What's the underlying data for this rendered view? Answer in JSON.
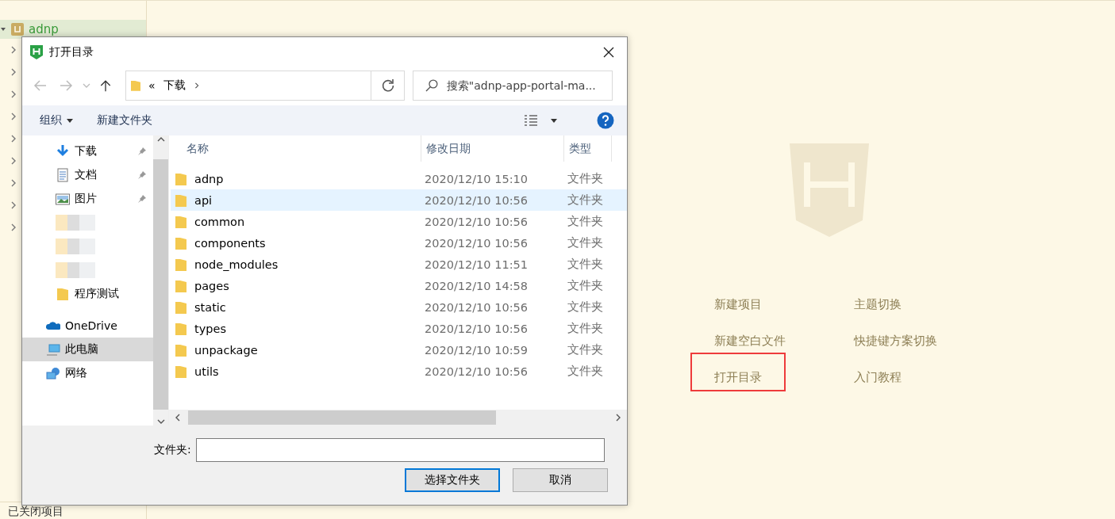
{
  "app": {
    "project": {
      "name": "adnp",
      "selected": true,
      "expanded": true
    },
    "tree_rows": [
      {
        "expanded": false
      },
      {
        "expanded": false
      },
      {
        "expanded": false
      },
      {
        "expanded": false
      },
      {
        "expanded": false
      },
      {
        "expanded": false
      },
      {
        "expanded": false
      },
      {
        "expanded": false
      },
      {
        "expanded": false
      }
    ],
    "closed_projects": "已关闭项目",
    "welcome_links": [
      {
        "label": "新建项目",
        "highlighted": false
      },
      {
        "label": "主题切换",
        "highlighted": false
      },
      {
        "label": "新建空白文件",
        "highlighted": false
      },
      {
        "label": "快捷键方案切换",
        "highlighted": false
      },
      {
        "label": "打开目录",
        "highlighted": true
      },
      {
        "label": "入门教程",
        "highlighted": false
      }
    ]
  },
  "dialog": {
    "title": "打开目录",
    "breadcrumb": [
      "«",
      "下载"
    ],
    "search": {
      "placeholder": "搜索\"adnp-app-portal-ma..."
    },
    "toolbar": {
      "organize": "组织",
      "new_folder": "新建文件夹"
    },
    "nav": [
      {
        "kind": "download",
        "label": "下载",
        "pinned": true,
        "selected": false
      },
      {
        "kind": "documents",
        "label": "文档",
        "pinned": true,
        "selected": false
      },
      {
        "kind": "pictures",
        "label": "图片",
        "pinned": true,
        "selected": false
      },
      {
        "kind": "redacted"
      },
      {
        "kind": "redacted"
      },
      {
        "kind": "redacted"
      },
      {
        "kind": "folder",
        "label": "程序测试",
        "pinned": false,
        "selected": false
      },
      {
        "kind": "onedrive",
        "label": "OneDrive",
        "pinned": false,
        "selected": false
      },
      {
        "kind": "pc",
        "label": "此电脑",
        "pinned": false,
        "selected": true
      },
      {
        "kind": "network",
        "label": "网络",
        "pinned": false,
        "selected": false
      }
    ],
    "columns": [
      "名称",
      "修改日期",
      "类型"
    ],
    "rows": [
      {
        "name": "adnp",
        "date": "2020/12/10 15:10",
        "type": "文件夹",
        "selected": false
      },
      {
        "name": "api",
        "date": "2020/12/10 10:56",
        "type": "文件夹",
        "selected": true
      },
      {
        "name": "common",
        "date": "2020/12/10 10:56",
        "type": "文件夹",
        "selected": false
      },
      {
        "name": "components",
        "date": "2020/12/10 10:56",
        "type": "文件夹",
        "selected": false
      },
      {
        "name": "node_modules",
        "date": "2020/12/10 11:51",
        "type": "文件夹",
        "selected": false
      },
      {
        "name": "pages",
        "date": "2020/12/10 14:58",
        "type": "文件夹",
        "selected": false
      },
      {
        "name": "static",
        "date": "2020/12/10 10:56",
        "type": "文件夹",
        "selected": false
      },
      {
        "name": "types",
        "date": "2020/12/10 10:56",
        "type": "文件夹",
        "selected": false
      },
      {
        "name": "unpackage",
        "date": "2020/12/10 10:59",
        "type": "文件夹",
        "selected": false
      },
      {
        "name": "utils",
        "date": "2020/12/10 10:56",
        "type": "文件夹",
        "selected": false
      }
    ],
    "folder_label": "文件夹:",
    "buttons": [
      {
        "label": "选择文件夹",
        "default": true
      },
      {
        "label": "取消",
        "default": false
      }
    ]
  }
}
